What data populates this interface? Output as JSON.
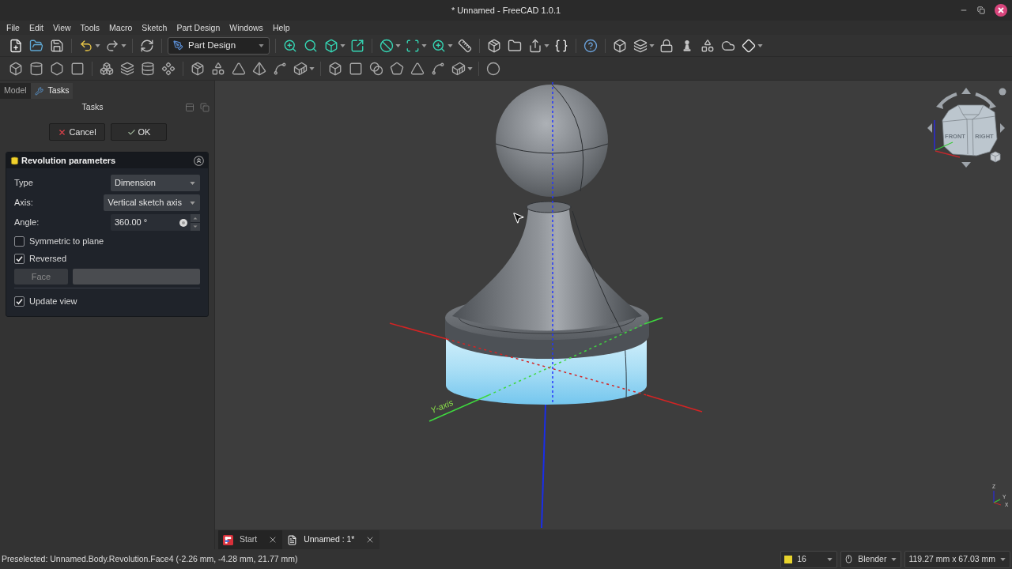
{
  "window": {
    "title": "* Unnamed - FreeCAD 1.0.1"
  },
  "menu": [
    "File",
    "Edit",
    "View",
    "Tools",
    "Macro",
    "Sketch",
    "Part Design",
    "Windows",
    "Help"
  ],
  "toolbar": {
    "workbench": "Part Design"
  },
  "combo_view": {
    "tabs": [
      {
        "kind": "model",
        "label": "Model",
        "selected": false
      },
      {
        "kind": "tasks",
        "label": "Tasks",
        "selected": true
      }
    ],
    "title": "Tasks",
    "buttons": [
      {
        "kind": "cancel",
        "label": "Cancel"
      },
      {
        "kind": "ok",
        "label": "OK"
      }
    ]
  },
  "revolution_parameters": {
    "title": "Revolution parameters",
    "fields": [
      {
        "kind": "combo",
        "label": "Type",
        "value": "Dimension"
      },
      {
        "kind": "combo",
        "label": "Axis:",
        "value": "Vertical sketch axis"
      },
      {
        "kind": "spin",
        "label": "Angle:",
        "value": "360.00 °"
      }
    ],
    "options": [
      {
        "label": "Symmetric to plane",
        "checked": false
      },
      {
        "label": "Reversed",
        "checked": true
      }
    ],
    "face": {
      "label": "Face",
      "disabled": true
    },
    "update_view": {
      "label": "Update view",
      "checked": true
    }
  },
  "viewport": {
    "axis_label": "Y-axis",
    "cube_faces": [
      "FRONT",
      "RIGHT"
    ],
    "triad_labels": [
      "Z",
      "Y",
      "X"
    ]
  },
  "document_tabs": [
    {
      "kind": "start",
      "label": "Start",
      "selected": false
    },
    {
      "kind": "document",
      "label": "Unnamed : 1*",
      "selected": true
    }
  ],
  "status_bar": {
    "message": "Preselected: Unnamed.Body.Revolution.Face4 (-2.26 mm, -4.28 mm, 21.77 mm)",
    "items": [
      {
        "kind": "count",
        "label": "16"
      },
      {
        "kind": "navigation",
        "label": "Blender"
      },
      {
        "kind": "dimensions",
        "label": "119.27 mm x 67.03 mm"
      }
    ]
  }
}
